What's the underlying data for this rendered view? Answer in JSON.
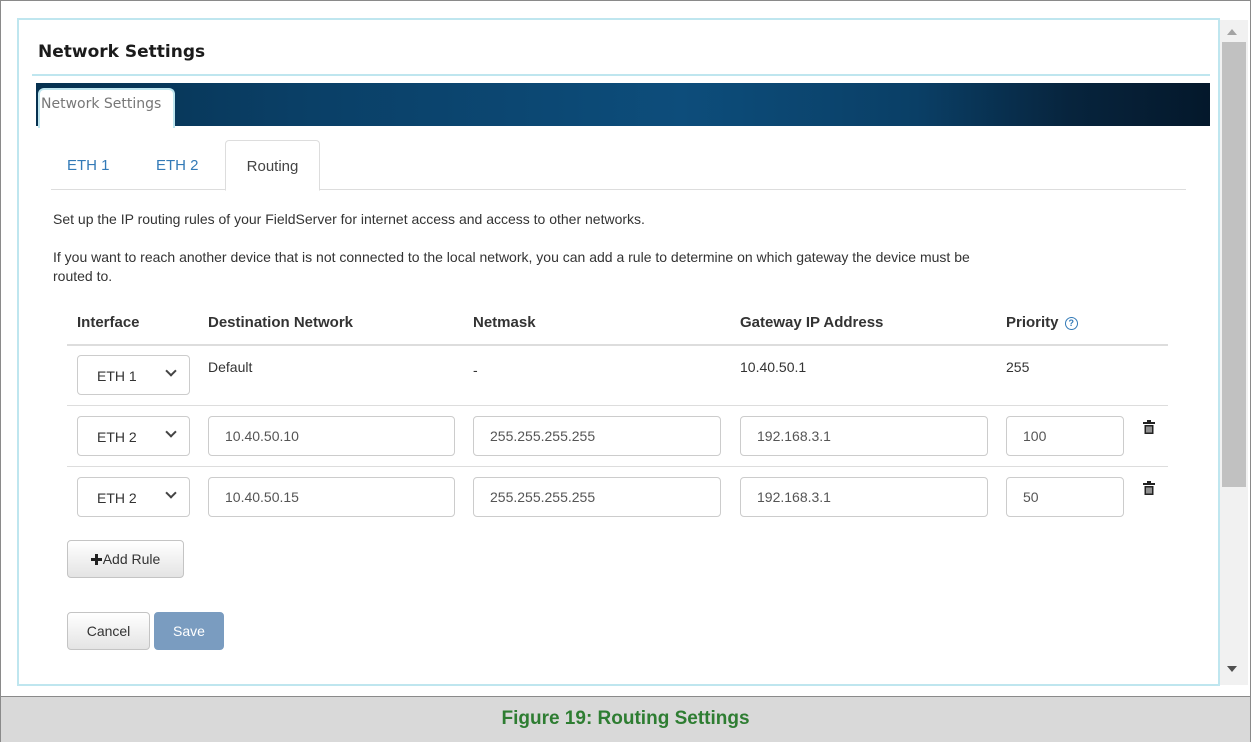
{
  "dialog": {
    "title": "Network Settings",
    "banner_tab": "Network Settings"
  },
  "tabs": [
    {
      "label": "ETH 1"
    },
    {
      "label": "ETH 2"
    },
    {
      "label": "Routing",
      "active": true
    }
  ],
  "description": {
    "line1": "Set up the IP routing rules of your FieldServer for internet access and access to other networks.",
    "line2a": "If you want to reach another device that is not connected to the local network, you can add a rule to determine on which gateway the device must be",
    "line2b": "routed to."
  },
  "table": {
    "headers": {
      "interface": "Interface",
      "destination": "Destination Network",
      "netmask": "Netmask",
      "gateway": "Gateway IP Address",
      "priority": "Priority"
    },
    "help_icon_glyph": "?",
    "rows": [
      {
        "interface": "ETH 1",
        "destination": "Default",
        "netmask": "-",
        "gateway": "10.40.50.1",
        "priority": "255"
      },
      {
        "interface": "ETH 2",
        "destination": "10.40.50.10",
        "netmask": "255.255.255.255",
        "gateway": "192.168.3.1",
        "priority": "100"
      },
      {
        "interface": "ETH 2",
        "destination": "10.40.50.15",
        "netmask": "255.255.255.255",
        "gateway": "192.168.3.1",
        "priority": "50"
      }
    ]
  },
  "buttons": {
    "add_rule": "Add Rule",
    "cancel": "Cancel",
    "save": "Save"
  },
  "caption": "Figure 19: Routing Settings",
  "colors": {
    "link": "#337ab7",
    "primary_disabled": "#7a9cc0",
    "caption_green": "#2e7d32",
    "banner_dark": "#04182b"
  }
}
